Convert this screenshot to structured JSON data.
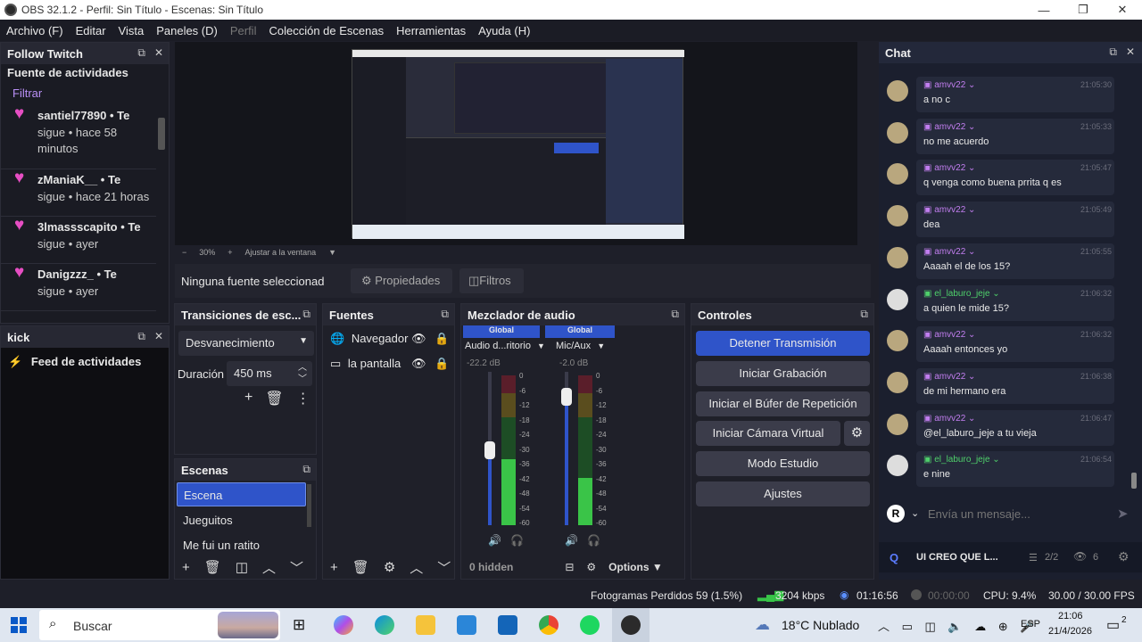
{
  "titlebar": {
    "title": "OBS 32.1.2 - Perfil: Sin Título - Escenas: Sin Título",
    "minimize": "—",
    "maximize": "❐",
    "close": "✕"
  },
  "menu": [
    "Archivo (F)",
    "Editar",
    "Vista",
    "Paneles (D)",
    "Perfil",
    "Colección de Escenas",
    "Herramientas",
    "Ayuda (H)"
  ],
  "follow_twitch": {
    "title": "Follow Twitch",
    "subtitle": "Fuente de actividades",
    "filter": "Filtrar",
    "items": [
      {
        "line1": "santiel77890 • Te",
        "line2": "sigue • hace 58",
        "line3": "minutos"
      },
      {
        "line1": "zManiaK__ • Te",
        "line2": "sigue • hace 21 horas",
        "line3": ""
      },
      {
        "line1": "3lmassscapito • Te",
        "line2": "sigue • ayer",
        "line3": ""
      },
      {
        "line1": "Danigzzz_ • Te",
        "line2": "sigue • ayer",
        "line3": ""
      }
    ]
  },
  "kick": {
    "title": "kick",
    "feed": "Feed de actividades"
  },
  "preview": {
    "zoom_minus": "−",
    "zoom": "30%",
    "zoom_plus": "+",
    "fit": "Ajustar a la ventana"
  },
  "source_toolbar": {
    "none": "Ninguna fuente seleccionad",
    "properties": "Propiedades",
    "filters": "Filtros"
  },
  "transitions": {
    "title": "Transiciones de esc...",
    "type": "Desvanecimiento",
    "duration_label": "Duración",
    "duration_value": "450 ms"
  },
  "scenes": {
    "title": "Escenas",
    "items": [
      "Escena",
      "Jueguitos",
      "Me fui un ratito"
    ]
  },
  "sources": {
    "title": "Fuentes",
    "items": [
      "Navegador",
      "la pantalla"
    ]
  },
  "mixer": {
    "title": "Mezclador de audio",
    "channels": [
      {
        "scope": "Global",
        "name": "Audio d...ritorio",
        "db": "-22.2 dB",
        "level": 0.45
      },
      {
        "scope": "Global",
        "name": "Mic/Aux",
        "db": "-2.0 dB",
        "level": 0.9
      }
    ],
    "scale": [
      "0",
      "-6",
      "-12",
      "-18",
      "-24",
      "-30",
      "-36",
      "-42",
      "-48",
      "-54",
      "-60"
    ],
    "hidden": "0 hidden",
    "options": "Options"
  },
  "controls": {
    "title": "Controles",
    "buttons": [
      "Detener Transmisión",
      "Iniciar Grabación",
      "Iniciar el Búfer de Repetición",
      "Iniciar Cámara Virtual",
      "Modo Estudio",
      "Ajustes"
    ]
  },
  "chat": {
    "title": "Chat",
    "messages": [
      {
        "user": "amvv22",
        "time": "21:05:30",
        "text": "a no c"
      },
      {
        "user": "amvv22",
        "time": "21:05:33",
        "text": "no me acuerdo"
      },
      {
        "user": "amvv22",
        "time": "21:05:47",
        "text": "q venga como buena prrita q es"
      },
      {
        "user": "amvv22",
        "time": "21:05:49",
        "text": "dea"
      },
      {
        "user": "amvv22",
        "time": "21:05:55",
        "text": "Aaaah el de los 15?"
      },
      {
        "user": "el_laburo_jeje",
        "time": "21:06:32",
        "text": "a quien le mide 15?"
      },
      {
        "user": "amvv22",
        "time": "21:06:32",
        "text": "Aaaah entonces yo"
      },
      {
        "user": "amvv22",
        "time": "21:06:38",
        "text": "de mi hermano era"
      },
      {
        "user": "amvv22",
        "time": "21:06:47",
        "text": "@el_laburo_jeje a tu vieja"
      },
      {
        "user": "el_laburo_jeje",
        "time": "21:06:54",
        "text": "e nine"
      }
    ],
    "input_avatar": "R",
    "placeholder": "Envía un mensaje...",
    "footer_title": "UI CREO QUE L...",
    "footer_count": "2/2",
    "viewers": "6"
  },
  "status": {
    "dropped": "Fotogramas Perdidos 59 (1.5%)",
    "kbps": "3204 kbps",
    "live": "01:16:56",
    "rec": "00:00:00",
    "cpu": "CPU: 9.4%",
    "fps": "30.00 / 30.00 FPS"
  },
  "taskbar": {
    "search": "Buscar",
    "weather": "18°C  Nublado",
    "lang": "ESP",
    "time": "21:06",
    "date": "21/4/2026",
    "notif": "2"
  }
}
